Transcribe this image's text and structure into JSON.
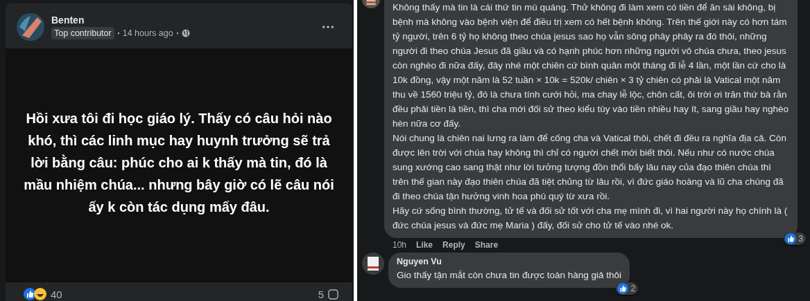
{
  "post": {
    "author": "Benten",
    "badge": "Top contributor",
    "time": "14 hours ago",
    "text": "Hồi xưa tôi đi học giáo lý. Thấy có câu hỏi nào khó, thì các linh mục hay huynh trưởng sẽ trả lời bằng câu: phúc cho ai k thấy mà tin, đó là mầu nhiệm chúa... nhưng bây giờ có lẽ câu nói ấy k còn tác dụng mấy đâu.",
    "reactions_count": "40",
    "comments_count": "5"
  },
  "comments": [
    {
      "paragraphs": [
        "Không thấy mà tin là cái thứ tin mù quáng. Thử không đi làm xem có tiền để ăn sài không, bị bệnh mà không vào bệnh viện để điều trị xem có hết bệnh không. Trên thế giới này có hơn tám tỷ người, trên 6 tỷ họ không theo chúa jesus sao họ vẫn sông phây phây ra đó thôi, những người đi theo chúa Jesus đã giầu và có hạnh phúc hơn những người vô chúa chưa, theo jesus còn nghèo đi nữa đấy, đây nhé một chiên cứ bình quân một tháng đi lễ 4 lần, một lần cứ cho là 10k đồng, vậy một năm là 52 tuần × 10k = 520k/ chiên × 3 tỷ chiên có phải là Vatical một năm thu về 1560 triệu tỷ, đó là chưa tính cưới hỏi, ma chay lễ lộc, chôn cất, ôi trời ơi trăn thứ bà rằn đều phải tiền là tiền, thì cha mới đối sử theo kiểu tùy vào tiền nhiều hay ít, sang giầu hay nghèo hèn nữa cơ đấy.",
        "Nói chung là chiên nai lưng ra làm để cống cha và Vatical thôi, chết đi đều ra nghĩa địa cả. Còn được lên trời với chúa hay không thì chỉ có người chết mới biết thôi. Nếu như có nước chúa sung xướng cao sang thật như lời tưởng tượng đồn thổi bấy lâu nay của đạo thiên chúa thì trên thế gian này đạo thiên chúa đã tiệt chủng từ lâu rồi, vì đức giáo hoàng và lũ cha chúng đã đi theo chúa tận hưởng vinh hoa phú quý từ xưa rồi.",
        "Hãy cứ sống bình thường, tử tế và đối sử tốt với cha mẹ mình đi, vì hai người này họ chính là ( đức chúa jesus và đức mẹ Maria ) đấy, đối sử cho tử tế vào nhé ok."
      ],
      "time": "10h",
      "actions": [
        "Like",
        "Reply",
        "Share"
      ],
      "reaction_count": "3"
    },
    {
      "author": "Nguyen Vu",
      "paragraphs": [
        "Gio thấy tận mắt còn chưa tin được toàn hàng giả thôi"
      ],
      "reaction_count": "2"
    }
  ]
}
